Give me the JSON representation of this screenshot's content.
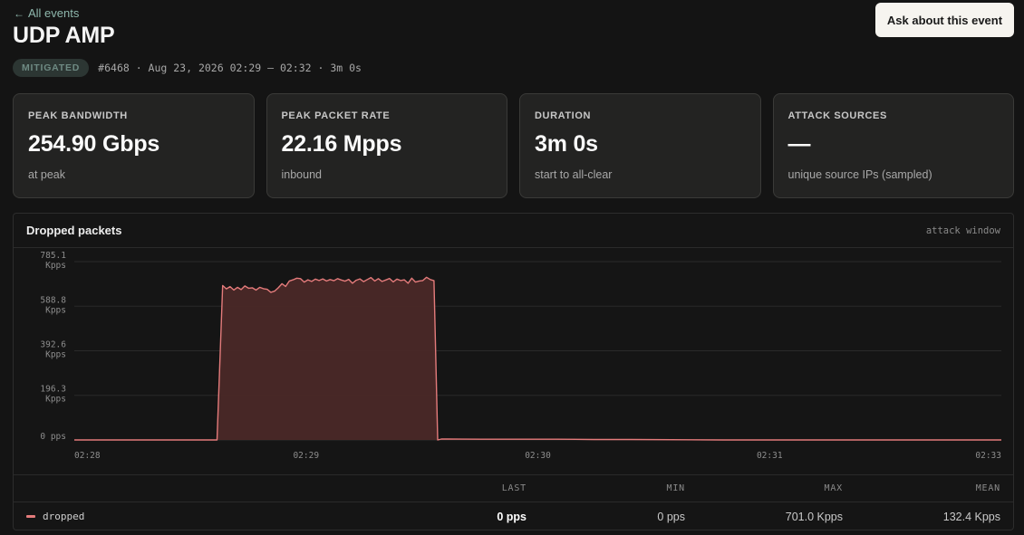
{
  "header": {
    "back_label": "All events",
    "title": "UDP AMP",
    "ask_button": "Ask about this event",
    "status_badge": "MITIGATED",
    "meta": "#6468 · Aug 23, 2026 02:29 – 02:32 · 3m 0s"
  },
  "cards": [
    {
      "label": "PEAK BANDWIDTH",
      "value": "254.90 Gbps",
      "sub": "at peak"
    },
    {
      "label": "PEAK PACKET RATE",
      "value": "22.16 Mpps",
      "sub": "inbound"
    },
    {
      "label": "DURATION",
      "value": "3m 0s",
      "sub": "start to all-clear"
    },
    {
      "label": "ATTACK SOURCES",
      "value": "—",
      "sub": "unique source IPs (sampled)"
    }
  ],
  "panel": {
    "title": "Dropped packets",
    "hint": "attack window"
  },
  "colors": {
    "series": "#e47b7b",
    "fill": "#4a2827"
  },
  "chart_data": {
    "type": "area",
    "x_ticks": [
      "02:28",
      "02:29",
      "02:30",
      "02:31",
      "02:33"
    ],
    "y_ticks": [
      {
        "value": 785.1,
        "line1": "785.1",
        "line2": "Kpps"
      },
      {
        "value": 588.8,
        "line1": "588.8",
        "line2": "Kpps"
      },
      {
        "value": 392.6,
        "line1": "392.6",
        "line2": "Kpps"
      },
      {
        "value": 196.3,
        "line1": "196.3",
        "line2": "Kpps"
      },
      {
        "value": 0,
        "line1": "0 pps",
        "line2": ""
      }
    ],
    "ylim": [
      0,
      785.1
    ],
    "xlim_minutes": [
      0,
      5
    ],
    "series": [
      {
        "x": [
          0,
          0.77,
          0.8,
          0.82,
          0.84,
          0.86,
          0.88,
          0.9,
          0.92,
          0.94,
          0.96,
          0.98,
          1.0,
          1.02,
          1.04,
          1.06,
          1.08,
          1.1,
          1.12,
          1.14,
          1.16,
          1.18,
          1.2,
          1.22,
          1.24,
          1.26,
          1.28,
          1.3,
          1.32,
          1.34,
          1.36,
          1.38,
          1.4,
          1.42,
          1.44,
          1.46,
          1.48,
          1.5,
          1.52,
          1.54,
          1.56,
          1.58,
          1.6,
          1.62,
          1.64,
          1.66,
          1.68,
          1.7,
          1.72,
          1.74,
          1.76,
          1.78,
          1.8,
          1.82,
          1.84,
          1.86,
          1.88,
          1.9,
          1.92,
          1.94,
          1.96,
          1.98,
          2.01,
          2.2,
          2.4,
          2.6,
          2.8,
          3.0,
          3.5,
          4.0,
          4.5,
          5.0
        ],
        "values": [
          0,
          0,
          680,
          665,
          675,
          660,
          672,
          662,
          678,
          668,
          670,
          660,
          672,
          666,
          663,
          650,
          655,
          670,
          688,
          676,
          700,
          705,
          712,
          710,
          695,
          705,
          698,
          708,
          702,
          709,
          700,
          706,
          701,
          710,
          704,
          699,
          707,
          690,
          703,
          709,
          697,
          706,
          715,
          700,
          710,
          698,
          704,
          711,
          696,
          708,
          702,
          705,
          690,
          712,
          695,
          700,
          702,
          716,
          706,
          701,
          0,
          4,
          4,
          3,
          3,
          3,
          2,
          2,
          0,
          0,
          0,
          0
        ]
      }
    ]
  },
  "stats": {
    "headers": [
      "LAST",
      "MIN",
      "MAX",
      "MEAN"
    ],
    "rows": [
      {
        "name": "dropped",
        "last": "0 pps",
        "min": "0 pps",
        "max": "701.0 Kpps",
        "mean": "132.4 Kpps"
      }
    ]
  }
}
